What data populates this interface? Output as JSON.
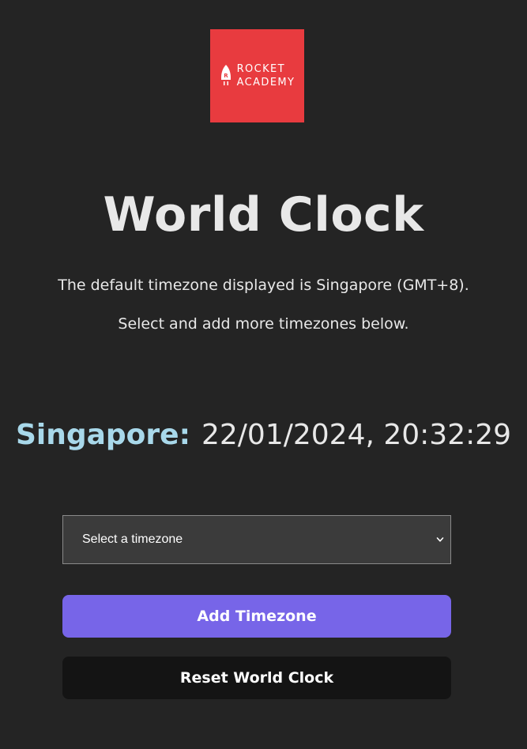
{
  "logo": {
    "line1": "ROCKET",
    "line2": "ACADEMY",
    "mark_letter": "R",
    "background_color": "#e83b3f"
  },
  "header": {
    "title": "World Clock",
    "subtitle_line1": "The default timezone displayed is Singapore (GMT+8).",
    "subtitle_line2": "Select and add more timezones below."
  },
  "clock": {
    "location": "Singapore:",
    "datetime": "22/01/2024, 20:32:29",
    "label_color": "#a8d8ea"
  },
  "timezone_select": {
    "selected_value": "Select a timezone",
    "icon": "chevron-down-icon"
  },
  "buttons": {
    "add_label": "Add Timezone",
    "add_color": "#7765e8",
    "reset_label": "Reset World Clock",
    "reset_color": "#141414"
  },
  "colors": {
    "page_background": "#242424",
    "text": "#e8e8e8"
  }
}
